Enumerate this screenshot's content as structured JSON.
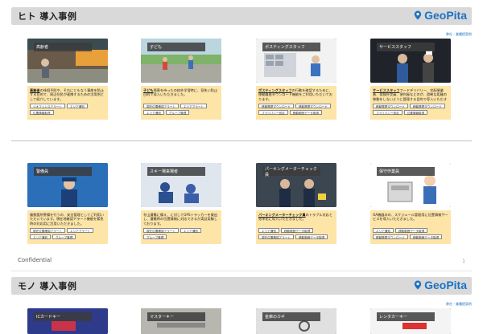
{
  "slide1": {
    "title": "ヒト 導入事例",
    "logo": "GeoPita",
    "note": "弊社・業種提案例",
    "row1": [
      {
        "tag": "高齢者",
        "key": "高齢者",
        "text": "の徘徊予防や、それにともなう事故を防止する目的で、周辺住民が連携するための活用例として紹介しています。",
        "buttons": [
          "ジオフェンスアラート",
          "エリア通知",
          "位置情報取得"
        ]
      },
      {
        "tag": "子ども",
        "key": "子ども",
        "text": "障害を持ったの校外学習時に、見失い防止目的で導入いただきました。",
        "buttons": [
          "現在位置確認アラート",
          "エリアアラート",
          "エリア通知",
          "グループ管理"
        ]
      },
      {
        "tag": "ポスティングスタッフ",
        "key": "ポスティングスタッフ",
        "text": "の行動を確認するために、移動履歴ダウンロード機能をご利用いただいております。",
        "buttons": [
          "移動履歴ダウンロード",
          "移動履歴ダウンロード",
          "プライバシー設定",
          "移動範囲データ取得"
        ]
      },
      {
        "tag": "サービススタッフ",
        "key": "サービススタッフ",
        "text": "フードデリバリー、宅配便業者、保険外交員、便利屋などのが、過剰な距離の移動をしないように管理する目的で導入いただきました。",
        "buttons": [
          "移動履歴ダウンロード",
          "移動履歴ダウンロード",
          "プライバシー設定",
          "位置情報取得"
        ]
      }
    ],
    "row2": [
      {
        "tag": "警備員",
        "key": "警備員",
        "text": "複数箇所警備を行うの、安全管理としてご利用いただいています。現在地確認アラート機能を緊急時の対応用に活用いただきました。",
        "buttons": [
          "現在位置確認アラート",
          "エリアアラート",
          "エリア通知",
          "グループ管理"
        ]
      },
      {
        "tag": "スキー場来場者",
        "key": "スキー場来場者",
        "text": "冬山遭難に備え、に対してGPSトラッカーを貸出し、遭難時の位置情報に対応できるか実証実験しております。",
        "buttons": [
          "現在位置確認アラート",
          "エリア通知",
          "グループ管理"
        ]
      },
      {
        "tag": "パーキングメーターチェック員",
        "key": "パーキングメーターチェック員",
        "text": "のトラブル対応と効率化に導入いただきました。",
        "buttons": [
          "エリア通知",
          "移動範囲データ取得",
          "現在位置確認アラート",
          "移動範囲データ取得"
        ]
      },
      {
        "tag": "保守作業員",
        "key": "保守作業員",
        "text": "OA機器のの、スケジュール管理用に位置情報サービスを導入いただきました。",
        "buttons": [
          "エリア通知",
          "移動範囲データ取得",
          "移動履歴ダウンロード",
          "移動範囲データ取得"
        ]
      }
    ],
    "confidential": "Confidential",
    "page": "1"
  },
  "slide2": {
    "title": "モノ 導入事例",
    "logo": "GeoPita",
    "note": "弊社・業種提案例",
    "row1": [
      {
        "tag": "ICカードキー"
      },
      {
        "tag": "マスターキー"
      },
      {
        "tag": "金庫のカギ"
      },
      {
        "tag": "レンタカーキー"
      }
    ]
  },
  "colors": {
    "accent": "#1b73c4",
    "header_bg": "#d9d9d9",
    "desc_bg": "#fde5a8"
  }
}
